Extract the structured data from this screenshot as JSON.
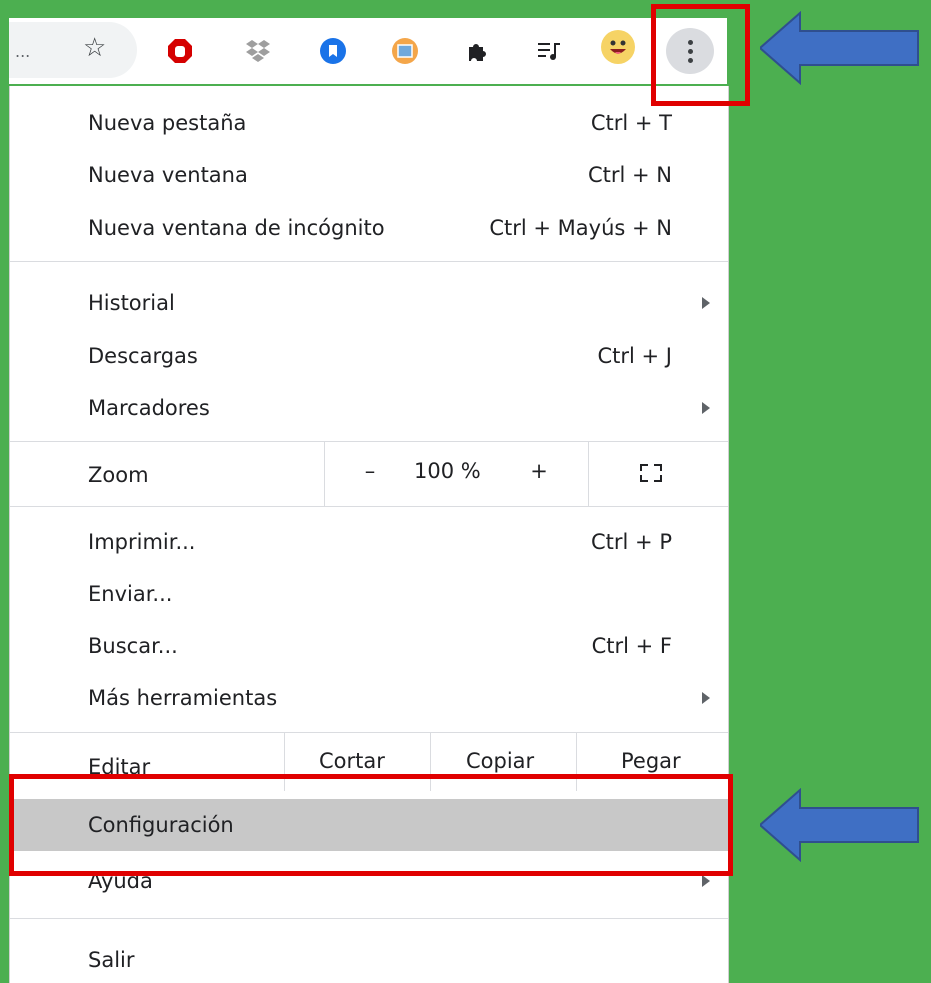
{
  "toolbar": {
    "overflow_label": "...",
    "bookmark_icon": "star-icon",
    "extensions": [
      "ublock-icon",
      "dropbox-icon",
      "bookmark-ext-icon",
      "image-ext-icon",
      "puzzle-icon",
      "media-queue-icon",
      "profile-avatar-icon"
    ],
    "menu_icon": "three-dots-vertical-icon"
  },
  "menu": {
    "new_tab": {
      "label": "Nueva pestaña",
      "shortcut": "Ctrl + T"
    },
    "new_window": {
      "label": "Nueva ventana",
      "shortcut": "Ctrl + N"
    },
    "incognito": {
      "label": "Nueva ventana de incógnito",
      "shortcut": "Ctrl + Mayús + N"
    },
    "history": {
      "label": "Historial"
    },
    "downloads": {
      "label": "Descargas",
      "shortcut": "Ctrl + J"
    },
    "bookmarks": {
      "label": "Marcadores"
    },
    "zoom": {
      "label": "Zoom",
      "minus": "–",
      "value": "100 %",
      "plus": "+"
    },
    "print": {
      "label": "Imprimir...",
      "shortcut": "Ctrl + P"
    },
    "cast": {
      "label": "Enviar..."
    },
    "find": {
      "label": "Buscar...",
      "shortcut": "Ctrl + F"
    },
    "more_tools": {
      "label": "Más herramientas"
    },
    "edit": {
      "label": "Editar",
      "cut": "Cortar",
      "copy": "Copiar",
      "paste": "Pegar"
    },
    "settings": {
      "label": "Configuración"
    },
    "help": {
      "label": "Ayuda"
    },
    "exit": {
      "label": "Salir"
    }
  },
  "colors": {
    "background": "#4caf50",
    "highlight": "#c8c8c8",
    "annotation_box": "#e00000",
    "annotation_arrow": "#3f6fc4"
  }
}
